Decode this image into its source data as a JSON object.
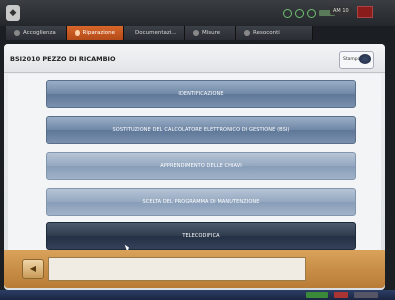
{
  "topbar": {
    "status_text": "AM 10"
  },
  "tabs": [
    {
      "label": "Accoglienza",
      "active": false
    },
    {
      "label": "Riparazione",
      "active": true
    },
    {
      "label": "Documentazi...",
      "active": false
    },
    {
      "label": "Misure",
      "active": false
    },
    {
      "label": "Resoconti",
      "active": false
    }
  ],
  "panel": {
    "title": "BSI2010  PEZZO DI RICAMBIO",
    "print_label": "Stampa"
  },
  "menu": [
    {
      "label": "IDENTIFICAZIONE",
      "style": "normal"
    },
    {
      "label": "SOSTITUZIONE DEL CALCOLATORE ELETTRONICO DI GESTIONE (BSI)",
      "style": "normal"
    },
    {
      "label": "APPRENDIMENTO DELLE CHIAVI",
      "style": "dim"
    },
    {
      "label": "SCELTA DEL PROGRAMMA DI MANUTENZIONE",
      "style": "dim"
    },
    {
      "label": "TELECODIFICA",
      "style": "dark"
    }
  ],
  "colors": {
    "active_tab": "#d8662a",
    "menu_button": "#6f87a6",
    "footer": "#c98f48"
  }
}
